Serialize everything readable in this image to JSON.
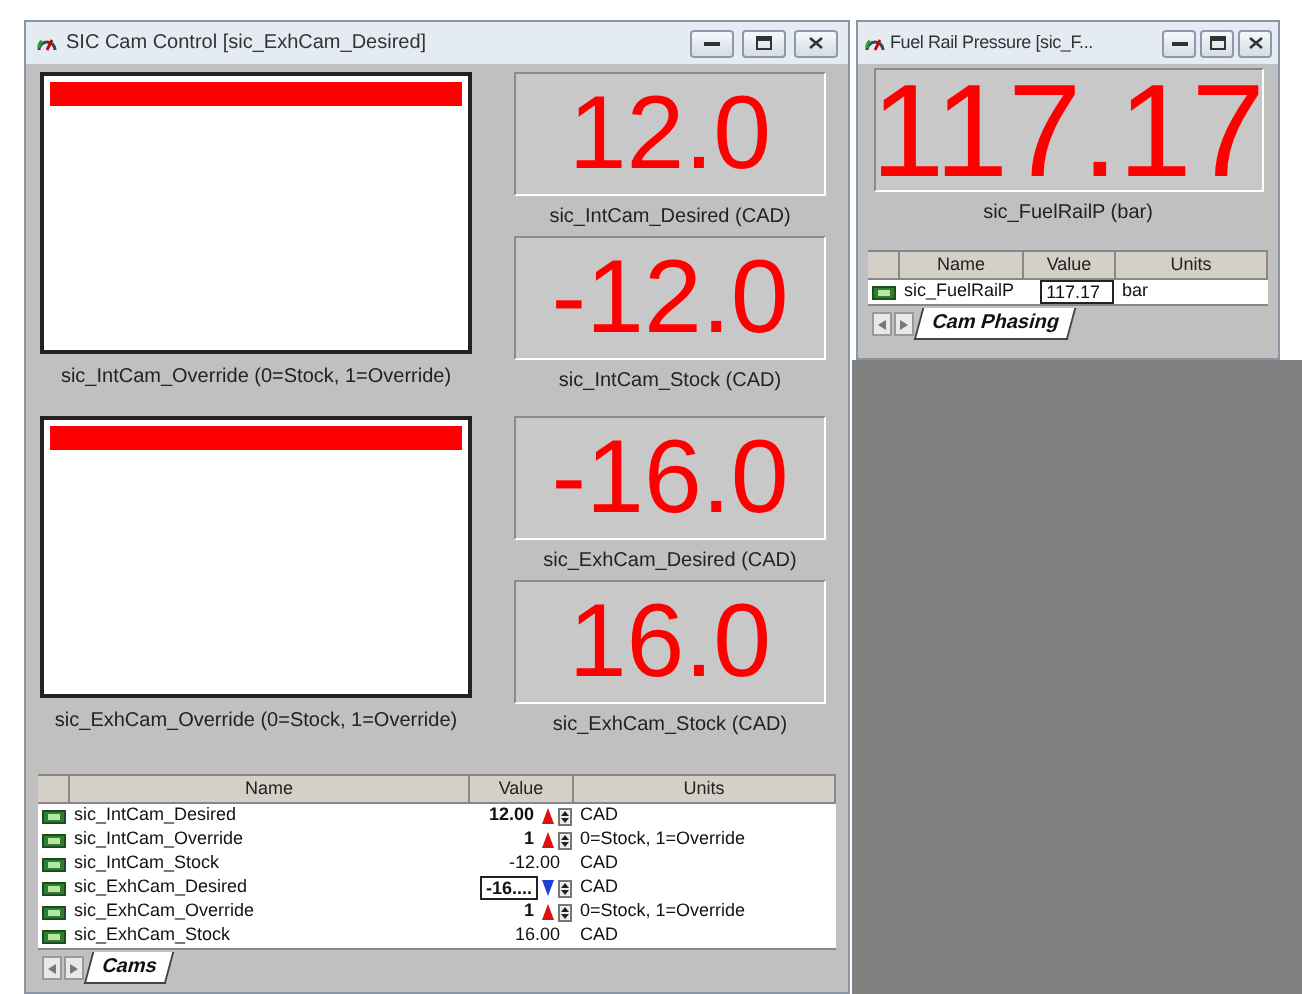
{
  "windows": [
    {
      "title": "SIC Cam Control [sic_ExhCam_Desired]",
      "indicators": [
        {
          "label": "sic_IntCam_Override (0=Stock, 1=Override)",
          "on": true
        },
        {
          "label": "sic_ExhCam_Override (0=Stock, 1=Override)",
          "on": true
        }
      ],
      "displays": [
        {
          "value": "12.0",
          "label": "sic_IntCam_Desired (CAD)"
        },
        {
          "value": "-12.0",
          "label": "sic_IntCam_Stock (CAD)"
        },
        {
          "value": "-16.0",
          "label": "sic_ExhCam_Desired (CAD)"
        },
        {
          "value": "16.0",
          "label": "sic_ExhCam_Stock (CAD)"
        }
      ],
      "table": {
        "columns": [
          "Name",
          "Value",
          "Units"
        ],
        "rows": [
          {
            "name": "sic_IntCam_Desired",
            "value": "12.00",
            "units": "CAD",
            "editable": true,
            "rising": true,
            "selected": false
          },
          {
            "name": "sic_IntCam_Override",
            "value": "1",
            "units": "0=Stock, 1=Override",
            "editable": true,
            "rising": true,
            "selected": false
          },
          {
            "name": "sic_IntCam_Stock",
            "value": "-12.00",
            "units": "CAD",
            "editable": false,
            "selected": false
          },
          {
            "name": "sic_ExhCam_Desired",
            "value": "-16....",
            "units": "CAD",
            "editable": true,
            "rising": false,
            "selected": true
          },
          {
            "name": "sic_ExhCam_Override",
            "value": "1",
            "units": "0=Stock, 1=Override",
            "editable": true,
            "rising": true,
            "selected": false
          },
          {
            "name": "sic_ExhCam_Stock",
            "value": "16.00",
            "units": "CAD",
            "editable": false,
            "selected": false
          }
        ]
      },
      "tabs": [
        {
          "label": "Cams",
          "selected": true
        }
      ]
    },
    {
      "title": "Fuel Rail Pressure [sic_F...",
      "displays": [
        {
          "value": "117.17",
          "label": "sic_FuelRailP (bar)"
        }
      ],
      "table": {
        "columns": [
          "Name",
          "Value",
          "Units"
        ],
        "rows": [
          {
            "name": "sic_FuelRailP",
            "value": "117.17",
            "units": "bar",
            "editable": false,
            "selected": true
          }
        ]
      },
      "tabs": [
        {
          "label": "Cam Phasing",
          "selected": true
        }
      ]
    }
  ]
}
